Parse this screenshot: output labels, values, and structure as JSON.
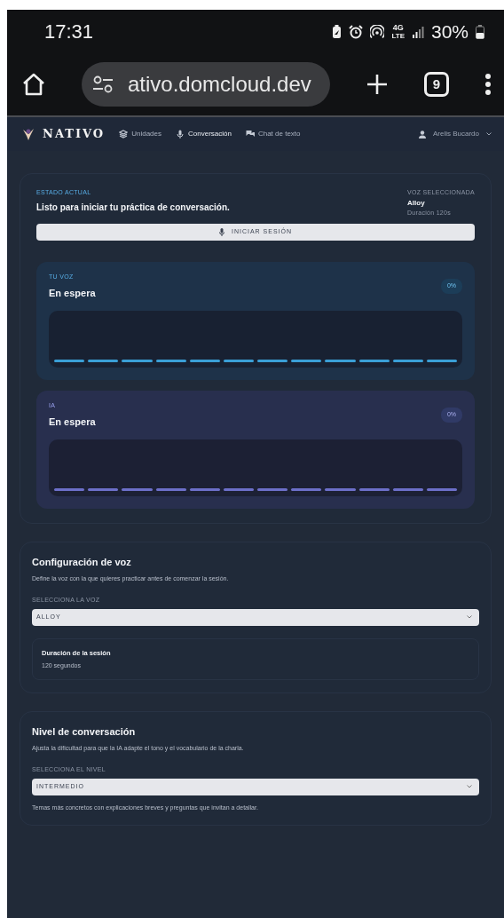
{
  "status_bar": {
    "time": "17:31",
    "network_top": "4G",
    "network_bottom": "LTE",
    "battery": "30%"
  },
  "browser": {
    "url": "ativo.domcloud.dev",
    "tab_count": "9"
  },
  "navbar": {
    "brand": "NATIVO",
    "items": [
      {
        "label": "Unidades",
        "kind": "layers",
        "selected": false
      },
      {
        "label": "Conversación",
        "kind": "mic",
        "selected": true
      },
      {
        "label": "Chat de texto",
        "kind": "chat",
        "selected": false
      }
    ],
    "user": "Arelis Bucardo"
  },
  "session": {
    "status_label": "ESTADO ACTUAL",
    "status_text": "Listo para iniciar tu práctica de conversación.",
    "voice_label": "VOZ SELECCIONADA",
    "voice_name": "Alloy",
    "duration": "Duración 120s",
    "start_button": "INICIAR SESIÓN",
    "meters": [
      {
        "kind": "user",
        "label": "TU VOZ",
        "state": "En espera",
        "reading": "0%"
      },
      {
        "kind": "ai",
        "label": "IA",
        "state": "En espera",
        "reading": "0%"
      }
    ]
  },
  "voice_config": {
    "title": "Configuración de voz",
    "description": "Define la voz con la que quieres practicar antes de comenzar la sesión.",
    "select_label": "SELECCIONA LA VOZ",
    "select_value": "ALLOY",
    "duration_title": "Duración de la sesión",
    "duration_value": "120 segundos"
  },
  "level_config": {
    "title": "Nivel de conversación",
    "description": "Ajusta la dificultad para que la IA adapte el tono y el vocabulario de la charla.",
    "select_label": "SELECCIONA EL NIVEL",
    "select_value": "INTERMEDIO",
    "note": "Temas más concretos con explicaciones breves y preguntas que invitan a detallar."
  }
}
